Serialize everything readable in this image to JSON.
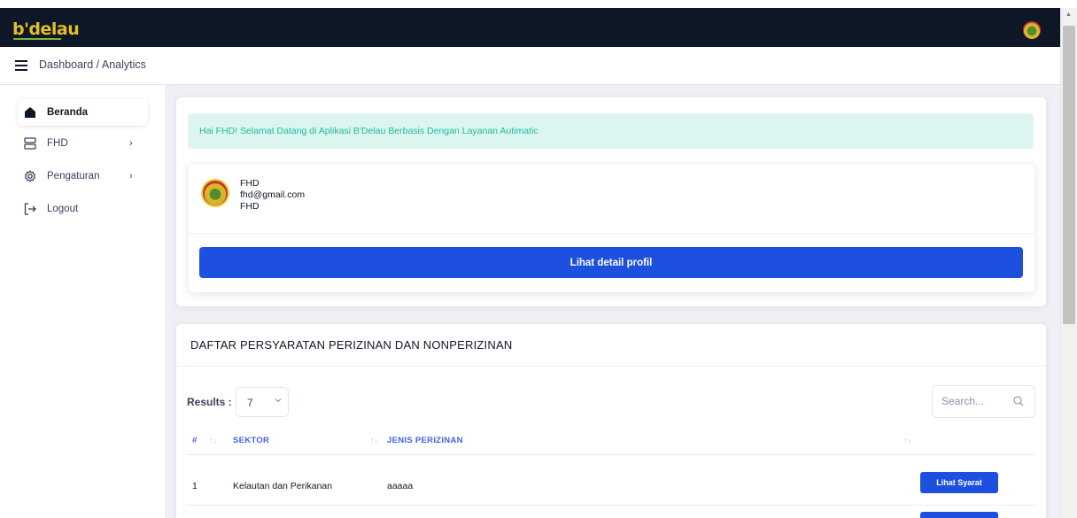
{
  "app": {
    "logo_text": "b'delau"
  },
  "breadcrumb": {
    "text": "Dashboard / Analytics"
  },
  "sidebar": {
    "items": [
      {
        "label": "Beranda",
        "icon": "home-icon",
        "active": true
      },
      {
        "label": "FHD",
        "icon": "server-icon",
        "has_submenu": true
      },
      {
        "label": "Pengaturan",
        "icon": "gear-icon",
        "has_submenu": true
      },
      {
        "label": "Logout",
        "icon": "logout-icon"
      }
    ],
    "chevron": "›"
  },
  "welcome": {
    "message": "Hai FHD! Selamat Datang di Aplikasi B'Delau Berbasis Dengan Layanan Autimatic"
  },
  "profile": {
    "name": "FHD",
    "email": "fhd@gmail.com",
    "role": "FHD",
    "detail_button": "Lihat detail profil"
  },
  "list": {
    "title": "DAFTAR PERSYARATAN PERIZINAN DAN NONPERIZINAN",
    "results_label": "Results :",
    "results_value": "7",
    "search_placeholder": "Search...",
    "columns": [
      "#",
      "SEKTOR",
      "JENIS PERIZINAN"
    ],
    "sort_glyph": "↑↓",
    "rows": [
      {
        "no": "1",
        "sektor": "Kelautan dan Perikanan",
        "jenis": "aaaaa",
        "action": "Lihat Syarat"
      }
    ]
  },
  "colors": {
    "navbar": "#0e1726",
    "primary": "#1d50de",
    "alert_bg": "#ddf5f0",
    "alert_text": "#1abc9c",
    "header_text": "#4361ee"
  }
}
